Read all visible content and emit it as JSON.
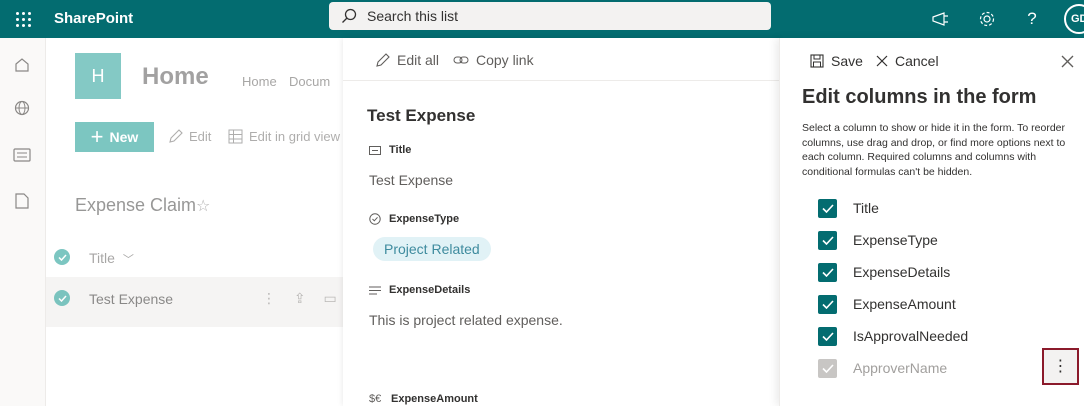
{
  "suitebar": {
    "brand": "SharePoint",
    "search_placeholder": "Search this list",
    "avatar_initials": "GD"
  },
  "site": {
    "logo_letter": "H",
    "title": "Home",
    "nav": [
      "Home",
      "Docum"
    ]
  },
  "commandbar": {
    "new_label": "New",
    "edit_label": "Edit",
    "grid_label": "Edit in grid view"
  },
  "list": {
    "title": "Expense Claim",
    "column_title": "Title",
    "rows": [
      {
        "title": "Test Expense"
      }
    ]
  },
  "item_panel": {
    "edit_all_label": "Edit all",
    "copy_link_label": "Copy link",
    "item_title": "Test Expense",
    "fields": [
      {
        "label": "Title",
        "value": "Test Expense"
      },
      {
        "label": "ExpenseType",
        "value": "Project Related"
      },
      {
        "label": "ExpenseDetails",
        "value": "This is project related expense."
      },
      {
        "label": "ExpenseAmount",
        "value": ""
      }
    ]
  },
  "edit_panel": {
    "save_label": "Save",
    "cancel_label": "Cancel",
    "heading": "Edit columns in the form",
    "description": "Select a column to show or hide it in the form. To reorder columns, use drag and drop, or find more options next to each column. Required columns and columns with conditional formulas can't be hidden.",
    "columns": [
      {
        "label": "Title",
        "checked": true,
        "disabled": false
      },
      {
        "label": "ExpenseType",
        "checked": true,
        "disabled": false
      },
      {
        "label": "ExpenseDetails",
        "checked": true,
        "disabled": false
      },
      {
        "label": "ExpenseAmount",
        "checked": true,
        "disabled": false
      },
      {
        "label": "IsApprovalNeeded",
        "checked": true,
        "disabled": false
      },
      {
        "label": "ApproverName",
        "checked": true,
        "disabled": true
      }
    ],
    "more_glyph": "⋮"
  },
  "colors": {
    "brand": "#036c70",
    "highlight_border": "#8b1a2b",
    "pill_bg": "#e1f2f6"
  }
}
